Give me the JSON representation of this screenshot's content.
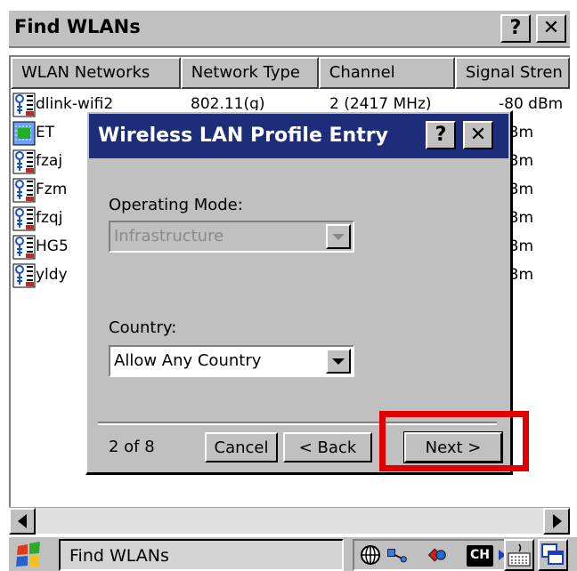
{
  "window": {
    "title": "Find WLANs",
    "help_label": "?",
    "close_label": "✕"
  },
  "list": {
    "columns": [
      "WLAN Networks",
      "Network Type",
      "Channel",
      "Signal Stren"
    ],
    "rows": [
      {
        "name": "dlink-wifi2",
        "type": "802.11(g)",
        "channel": "2 (2417 MHz)",
        "signal": "-80 dBm",
        "icon": "access-point-icon"
      },
      {
        "name": "ET",
        "type": "",
        "channel": "",
        "signal": "dBm",
        "icon": "adhoc-network-icon"
      },
      {
        "name": "fzaj",
        "type": "",
        "channel": "",
        "signal": "dBm",
        "icon": "access-point-icon"
      },
      {
        "name": "Fzm",
        "type": "",
        "channel": "",
        "signal": "dBm",
        "icon": "access-point-icon"
      },
      {
        "name": "fzqj",
        "type": "",
        "channel": "",
        "signal": "dBm",
        "icon": "access-point-icon"
      },
      {
        "name": "HG5",
        "type": "",
        "channel": "",
        "signal": "dBm",
        "icon": "access-point-icon"
      },
      {
        "name": "yldy",
        "type": "",
        "channel": "",
        "signal": "dBm",
        "icon": "access-point-icon"
      }
    ]
  },
  "dialog": {
    "title": "Wireless LAN Profile Entry",
    "help_label": "?",
    "close_label": "✕",
    "operating_mode_label": "Operating Mode:",
    "operating_mode_value": "Infrastructure",
    "country_label": "Country:",
    "country_value": "Allow Any Country",
    "page_indicator": "2 of 8",
    "cancel_label": "Cancel",
    "back_label": "< Back",
    "next_label": "Next >"
  },
  "taskbar": {
    "task_label": "Find WLANs",
    "input_indicator": "CH"
  },
  "colors": {
    "dialog_title_bg": "#1e2d7a",
    "highlight": "#e00000",
    "face": "#c0c0c0"
  }
}
